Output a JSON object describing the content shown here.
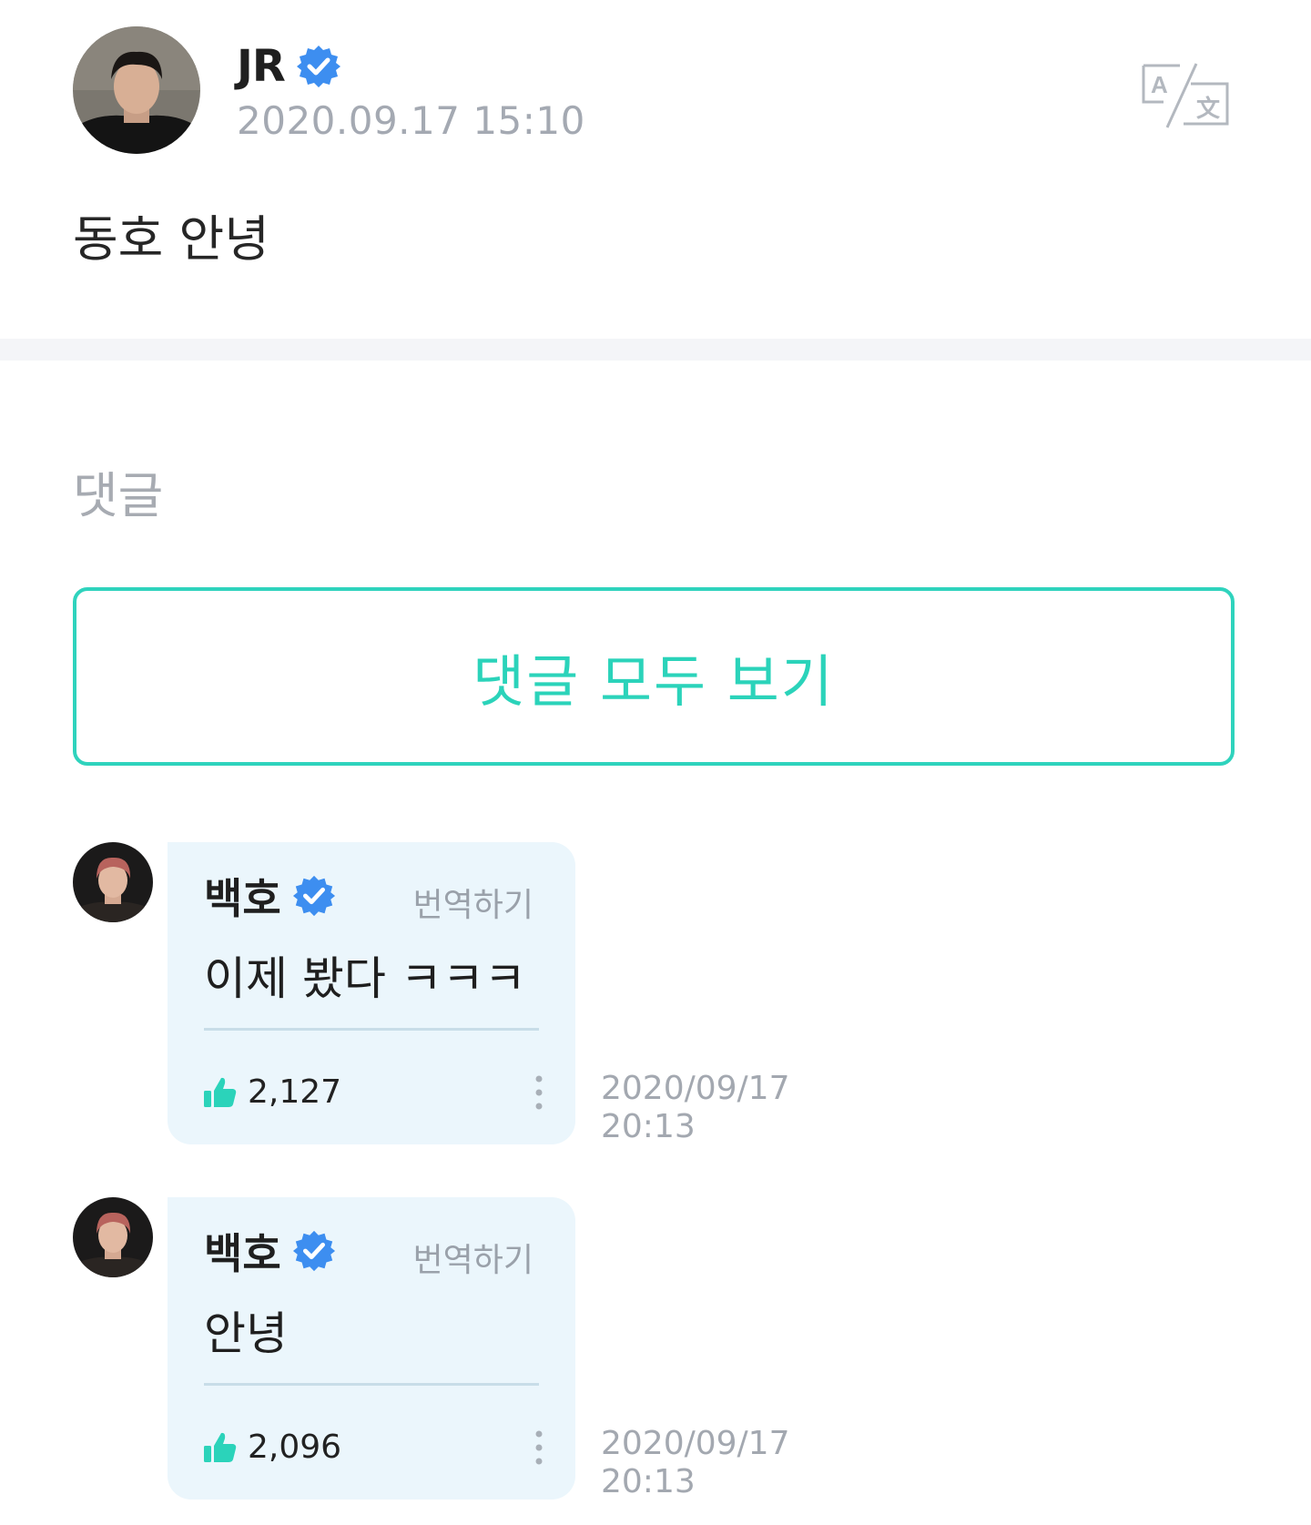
{
  "post": {
    "author": "JR",
    "timestamp": "2020.09.17 15:10",
    "body": "동호 안녕",
    "avatar_icon": "profile-photo",
    "verified_icon": "verified-badge-icon",
    "translate_icon": "translate-icon"
  },
  "comments_section": {
    "title": "댓글",
    "view_all_label": "댓글 모두 보기"
  },
  "comments": [
    {
      "author": "백호",
      "translate_label": "번역하기",
      "text": "이제 봤다 ㅋㅋㅋ",
      "likes": "2,127",
      "date": "2020/09/17",
      "time": "20:13"
    },
    {
      "author": "백호",
      "translate_label": "번역하기",
      "text": "안녕",
      "likes": "2,096",
      "date": "2020/09/17",
      "time": "20:13"
    }
  ],
  "colors": {
    "accent": "#2bd3ba",
    "verified": "#3d8ef0",
    "muted_text": "#a4a9b2",
    "bubble_bg": "#ebf6fc",
    "divider_bg": "#f4f5f8"
  }
}
